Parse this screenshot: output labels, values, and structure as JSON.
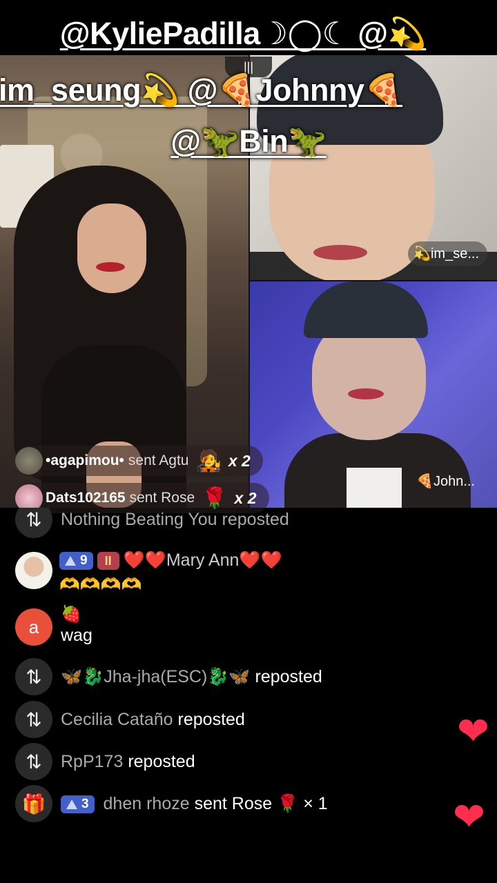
{
  "caption": {
    "line1": "@KyliePadilla☽◯☾ @💫",
    "line2": "im_seung💫 @🍕Johnny🍕",
    "line3": "@🦖Bin🦖"
  },
  "top_handle": "|||",
  "tiles": {
    "top_right_name": "💫im_se...",
    "bottom_right_name": "🍕John..."
  },
  "gifts": [
    {
      "user": "•agapimou•",
      "action": "sent Agtu",
      "icon": "🧑‍🎤",
      "count": "x 2"
    },
    {
      "user": "Dats102165",
      "action": "sent Rose",
      "icon": "🌹",
      "count": "x 2"
    }
  ],
  "chat": {
    "partial_row": {
      "icon": "⇅",
      "text": "Nothing Beating You reposted"
    },
    "mary": {
      "level_badge": "9",
      "fan_badge": "II",
      "name": "❤️❤️Mary Ann❤️❤️",
      "message": "🫶🫶🫶🫶"
    },
    "a_user": {
      "initial": "a",
      "emoji": "🍓",
      "message": "wag"
    },
    "reposts": [
      {
        "icon": "⇅",
        "user": "🦋🐉Jha-jha(ESC)🐉🦋",
        "action": "reposted"
      },
      {
        "icon": "⇅",
        "user": "Cecilia Cataño",
        "action": "reposted"
      },
      {
        "icon": "⇅",
        "user": "RpP173",
        "action": "reposted"
      }
    ],
    "gift_row": {
      "icon": "🎁",
      "level_badge": "3",
      "user": "dhen rhoze",
      "action": "sent Rose",
      "gift": "🌹",
      "count": "× 1"
    }
  },
  "hearts": [
    "❤",
    "❤"
  ],
  "colors": {
    "heart": "#ff2d4e",
    "level_badge": "#4360c9",
    "avatar_a": "#e8503a"
  }
}
